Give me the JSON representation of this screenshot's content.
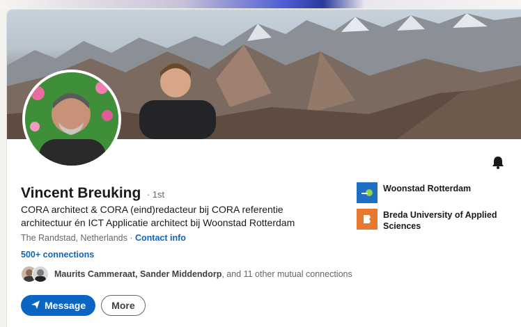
{
  "profile": {
    "name": "Vincent Breuking",
    "degree": "· 1st",
    "headline": "CORA architect & CORA (eind)redacteur bij CORA referentie architectuur én ICT Applicatie architect bij Woonstad Rotterdam",
    "location": "The Randstad, Netherlands ·",
    "contact_link": "Contact info",
    "connections": "500+ connections",
    "mutual_names": "Maurits Cammeraat, Sander Middendorp",
    "mutual_rest": ", and 11 other mutual connections"
  },
  "organizations": [
    {
      "name": "Woonstad Rotterdam",
      "icon": "woonstad-logo",
      "color": "#1e6fc4"
    },
    {
      "name": "Breda University of Applied Sciences",
      "icon": "breda-university-logo",
      "color": "#e8782f"
    }
  ],
  "actions": {
    "message_label": "Message",
    "more_label": "More"
  },
  "icons": {
    "bell": "bell-icon",
    "send": "send-icon"
  },
  "colors": {
    "link": "#0a66c2",
    "primary_button": "#0a66c2",
    "muted_text": "#666666"
  }
}
